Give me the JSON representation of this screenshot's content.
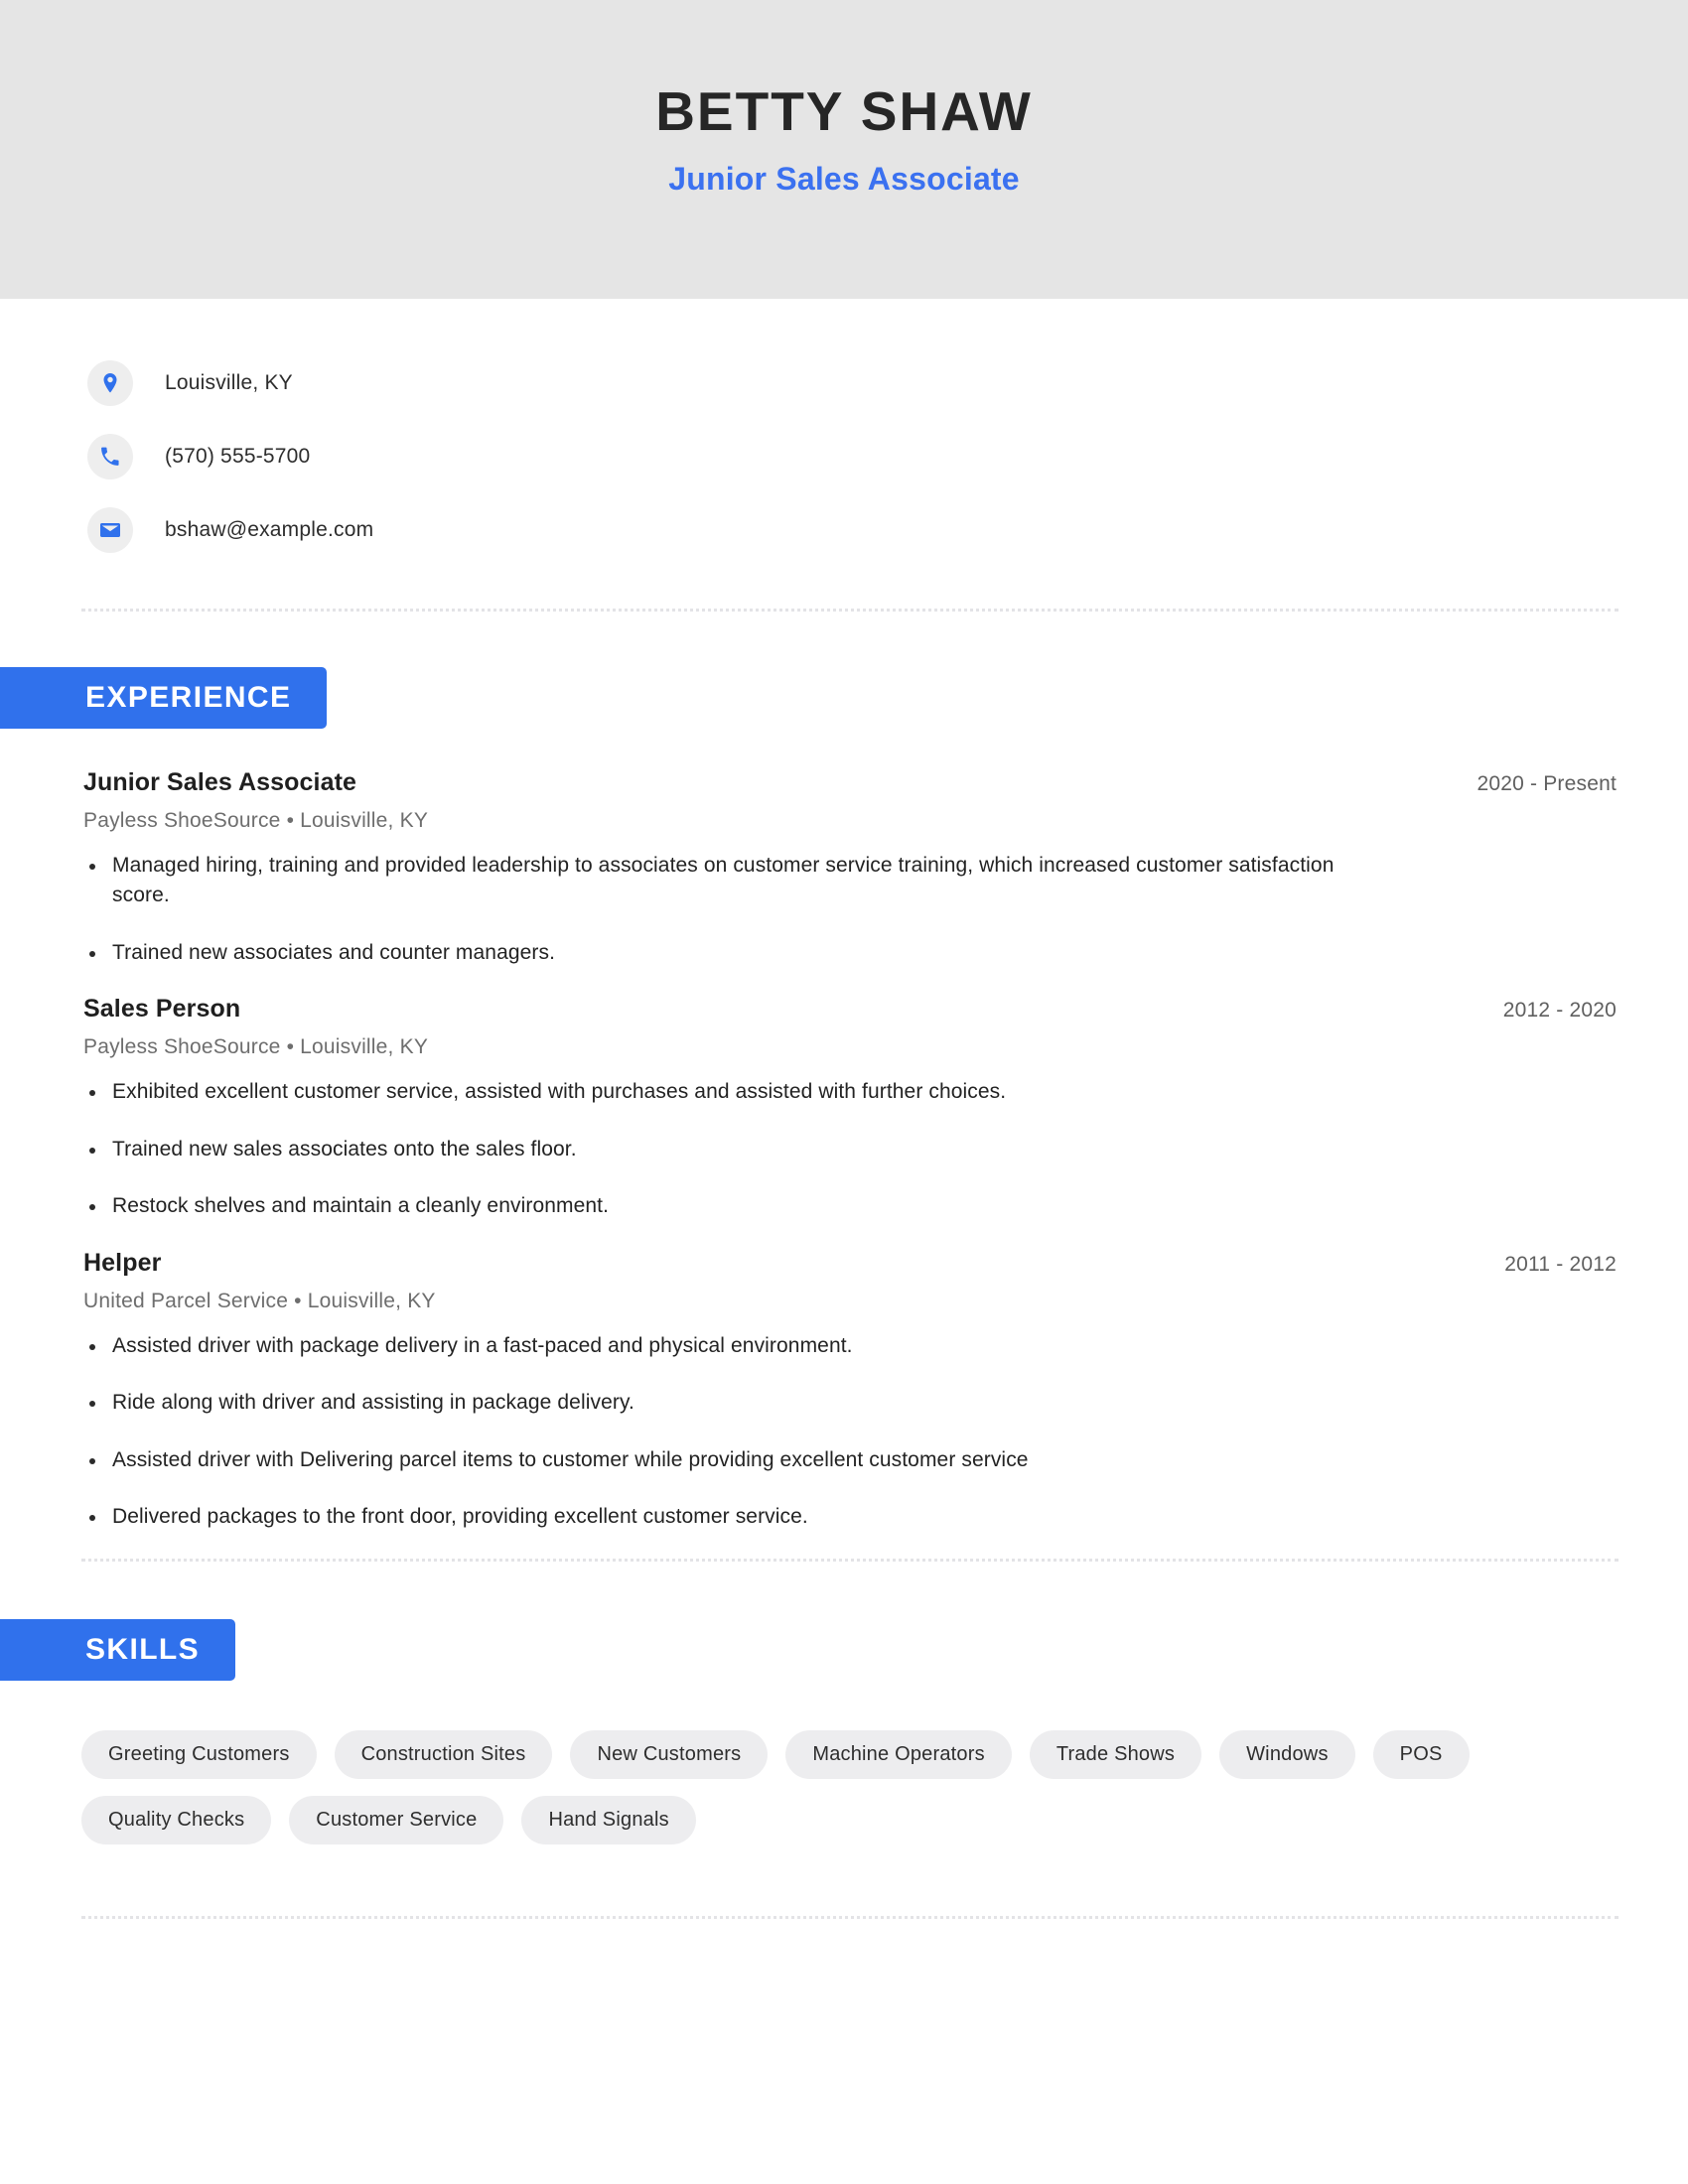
{
  "header": {
    "name": "BETTY SHAW",
    "job_title": "Junior Sales Associate",
    "background_color": "#e5e5e5",
    "accent_color": "#3071ec"
  },
  "contact": {
    "items": [
      {
        "icon": "location-pin-icon",
        "value": "Louisville, KY"
      },
      {
        "icon": "phone-icon",
        "value": "(570) 555-5700"
      },
      {
        "icon": "email-icon",
        "value": "bshaw@example.com"
      }
    ]
  },
  "sections": {
    "experience": {
      "heading": "EXPERIENCE",
      "jobs": [
        {
          "role": "Junior Sales Associate",
          "dates": "2020 - Present",
          "meta": "Payless ShoeSource  •  Louisville, KY",
          "bullets": [
            "Managed hiring, training and provided leadership to associates on customer service training, which increased customer satisfaction score.",
            "Trained new associates and counter managers."
          ]
        },
        {
          "role": "Sales Person",
          "dates": "2012 - 2020",
          "meta": "Payless ShoeSource  •  Louisville, KY",
          "bullets": [
            "Exhibited excellent customer service, assisted with purchases and assisted with further choices.",
            "Trained new sales associates onto the sales floor.",
            "Restock shelves and maintain a cleanly environment."
          ]
        },
        {
          "role": "Helper",
          "dates": "2011 - 2012",
          "meta": "United Parcel Service  •  Louisville, KY",
          "bullets": [
            "Assisted driver with package delivery in a fast-paced and physical environment.",
            "Ride along with driver and assisting in package delivery.",
            "Assisted driver with Delivering parcel items to customer while providing excellent customer service",
            "Delivered packages to the front door, providing excellent customer service."
          ]
        }
      ]
    },
    "skills": {
      "heading": "SKILLS",
      "items": [
        "Greeting Customers",
        "Construction Sites",
        "New Customers",
        "Machine Operators",
        "Trade Shows",
        "Windows",
        "POS",
        "Quality Checks",
        "Customer Service",
        "Hand Signals"
      ]
    }
  }
}
